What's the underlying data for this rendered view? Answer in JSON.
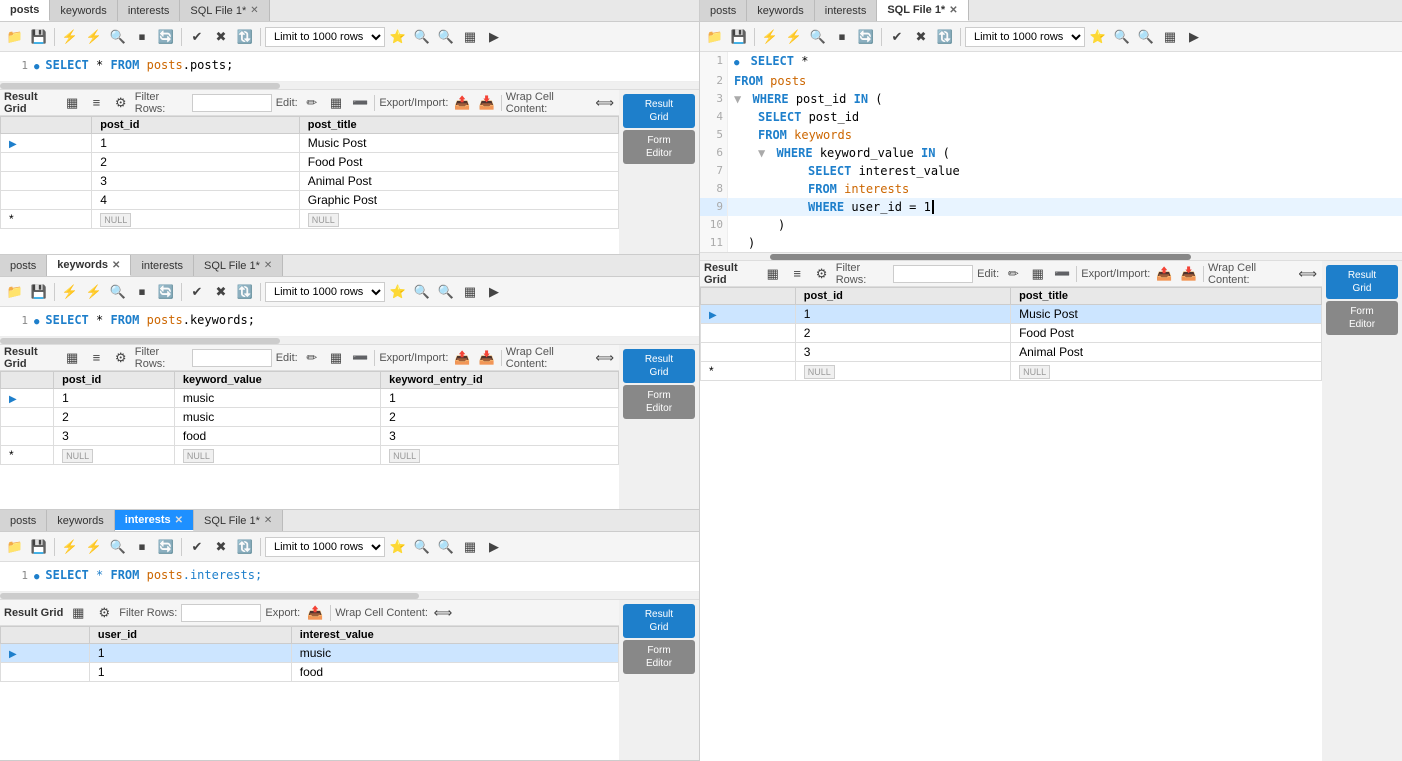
{
  "leftPanes": [
    {
      "id": "pane1",
      "tabs": [
        {
          "label": "posts",
          "active": true,
          "closable": false
        },
        {
          "label": "keywords",
          "active": false,
          "closable": false
        },
        {
          "label": "interests",
          "active": false,
          "closable": false
        },
        {
          "label": "SQL File 1*",
          "active": false,
          "closable": true
        }
      ],
      "sql": "SELECT * FROM posts.posts;",
      "lineNum": 1,
      "columns": [
        "post_id",
        "post_title"
      ],
      "rows": [
        {
          "cells": [
            "1",
            "Music Post"
          ],
          "selected": false
        },
        {
          "cells": [
            "2",
            "Food Post"
          ],
          "selected": false
        },
        {
          "cells": [
            "3",
            "Animal Post"
          ],
          "selected": false
        },
        {
          "cells": [
            "4",
            "Graphic Post"
          ],
          "selected": false
        }
      ]
    },
    {
      "id": "pane2",
      "tabs": [
        {
          "label": "posts",
          "active": false,
          "closable": false
        },
        {
          "label": "keywords",
          "active": true,
          "closable": true
        },
        {
          "label": "interests",
          "active": false,
          "closable": false
        },
        {
          "label": "SQL File 1*",
          "active": false,
          "closable": true
        }
      ],
      "sql": "SELECT * FROM posts.keywords;",
      "lineNum": 1,
      "columns": [
        "post_id",
        "keyword_value",
        "keyword_entry_id"
      ],
      "rows": [
        {
          "cells": [
            "1",
            "music",
            "1"
          ],
          "selected": false
        },
        {
          "cells": [
            "2",
            "music",
            "2"
          ],
          "selected": false
        },
        {
          "cells": [
            "3",
            "food",
            "3"
          ],
          "selected": false
        }
      ]
    },
    {
      "id": "pane3",
      "tabs": [
        {
          "label": "posts",
          "active": false,
          "closable": false
        },
        {
          "label": "keywords",
          "active": false,
          "closable": false
        },
        {
          "label": "interests",
          "active": true,
          "closable": true
        },
        {
          "label": "SQL File 1*",
          "active": false,
          "closable": true
        }
      ],
      "sql": "SELECT * FROM posts.interests;",
      "lineNum": 1,
      "columns": [
        "user_id",
        "interest_value"
      ],
      "rows": [
        {
          "cells": [
            "1",
            "music"
          ],
          "selected": true
        },
        {
          "cells": [
            "1",
            "food"
          ],
          "selected": false
        }
      ]
    }
  ],
  "rightPane": {
    "tabs": [
      {
        "label": "posts",
        "active": false,
        "closable": false
      },
      {
        "label": "keywords",
        "active": false,
        "closable": false
      },
      {
        "label": "interests",
        "active": false,
        "closable": false
      },
      {
        "label": "SQL File 1*",
        "active": true,
        "closable": true
      }
    ],
    "sqlLines": [
      {
        "num": 1,
        "indent": 0,
        "content": "SELECT *",
        "collapse": false
      },
      {
        "num": 2,
        "indent": 0,
        "content": "FROM posts",
        "collapse": false
      },
      {
        "num": 3,
        "indent": 0,
        "content": "WHERE post_id IN (",
        "collapse": true
      },
      {
        "num": 4,
        "indent": 2,
        "content": "SELECT post_id",
        "collapse": false
      },
      {
        "num": 5,
        "indent": 2,
        "content": "FROM keywords",
        "collapse": false
      },
      {
        "num": 6,
        "indent": 2,
        "content": "WHERE keyword_value IN (",
        "collapse": true
      },
      {
        "num": 7,
        "indent": 4,
        "content": "SELECT interest_value",
        "collapse": false
      },
      {
        "num": 8,
        "indent": 4,
        "content": "FROM interests",
        "collapse": false
      },
      {
        "num": 9,
        "indent": 4,
        "content": "WHERE user_id = 1",
        "collapse": false,
        "cursor": true
      },
      {
        "num": 10,
        "indent": 3,
        "content": ")",
        "collapse": false
      },
      {
        "num": 11,
        "indent": 1,
        "content": ")",
        "collapse": false
      }
    ],
    "columns": [
      "post_id",
      "post_title"
    ],
    "rows": [
      {
        "cells": [
          "1",
          "Music Post"
        ],
        "selected": true
      },
      {
        "cells": [
          "2",
          "Food Post"
        ],
        "selected": false
      },
      {
        "cells": [
          "3",
          "Animal Post"
        ],
        "selected": false
      }
    ]
  },
  "labels": {
    "resultGrid": "Result Grid",
    "formEditor": "Form Editor",
    "filterRows": "Filter Rows:",
    "edit": "Edit:",
    "exportImport": "Export/Import:",
    "wrapCellContent": "Wrap Cell Content:",
    "limitRows": "Limit to 1000 rows",
    "export": "Export:",
    "nullBadge": "NULL"
  }
}
